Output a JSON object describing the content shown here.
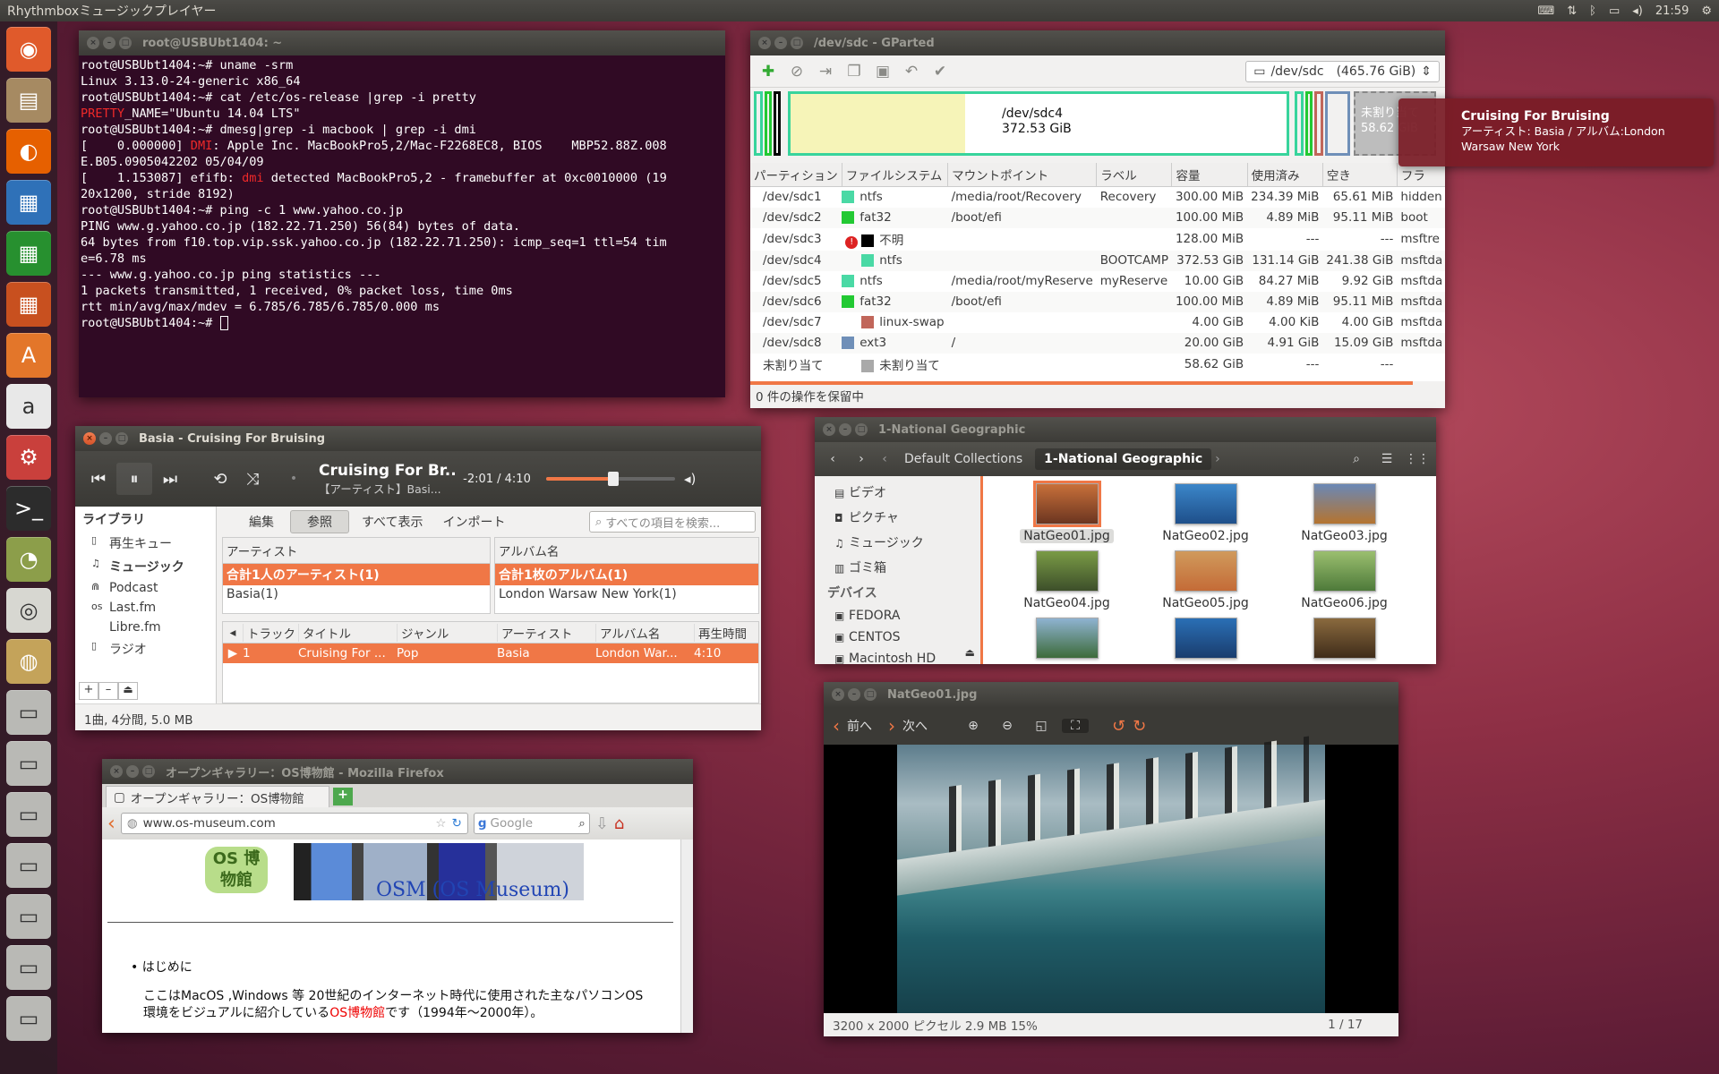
{
  "topbar": {
    "app_title": "Rhythmboxミュージックプレイヤー",
    "clock": "21:59",
    "indicators": [
      "keyboard-icon",
      "network-icon",
      "bluetooth-icon",
      "battery-icon",
      "volume-icon",
      "gear-icon"
    ]
  },
  "launcher": {
    "items": [
      {
        "name": "ubuntu-dash-icon",
        "glyph": "◉",
        "color": "#e05a2b"
      },
      {
        "name": "files-icon",
        "glyph": "▤",
        "color": "#a68a62"
      },
      {
        "name": "firefox-icon",
        "glyph": "◐",
        "color": "#e66000"
      },
      {
        "name": "writer-icon",
        "glyph": "▦",
        "color": "#2f71b8"
      },
      {
        "name": "calc-icon",
        "glyph": "▦",
        "color": "#27902f"
      },
      {
        "name": "impress-icon",
        "glyph": "▦",
        "color": "#c8501f"
      },
      {
        "name": "software-center-icon",
        "glyph": "A",
        "color": "#e3762a"
      },
      {
        "name": "amazon-icon",
        "glyph": "a",
        "color": "#e8e8e8"
      },
      {
        "name": "settings-icon",
        "glyph": "⚙",
        "color": "#c9403c"
      },
      {
        "name": "terminal-icon",
        "glyph": ">_",
        "color": "#2c2c2c"
      },
      {
        "name": "gparted-icon",
        "glyph": "◔",
        "color": "#8c9e4a"
      },
      {
        "name": "rhythmbox-icon",
        "glyph": "◎",
        "color": "#d7d7d1"
      },
      {
        "name": "image-viewer-icon",
        "glyph": "◍",
        "color": "#c4a35a"
      },
      {
        "name": "drive-icon-1",
        "glyph": "▭",
        "color": "#b9b9b5"
      },
      {
        "name": "drive-icon-2",
        "glyph": "▭",
        "color": "#b9b9b5"
      },
      {
        "name": "drive-icon-3",
        "glyph": "▭",
        "color": "#b9b9b5"
      },
      {
        "name": "drive-icon-4",
        "glyph": "▭",
        "color": "#b9b9b5"
      },
      {
        "name": "drive-icon-5",
        "glyph": "▭",
        "color": "#b9b9b5"
      },
      {
        "name": "drive-icon-6",
        "glyph": "▭",
        "color": "#b9b9b5"
      },
      {
        "name": "drive-icon-7",
        "glyph": "▭",
        "color": "#b9b9b5"
      }
    ]
  },
  "terminal": {
    "title": "root@USBUbt1404: ~",
    "lines": [
      [
        {
          "t": "root@USBUbt1404:~# uname -srm"
        }
      ],
      [
        {
          "t": "Linux 3.13.0-24-generic x86_64"
        }
      ],
      [
        {
          "t": "root@USBUbt1404:~# cat /etc/os-release |grep -i pretty"
        }
      ],
      [
        {
          "t": "PRETTY",
          "c": "red"
        },
        {
          "t": "_NAME=\"Ubuntu 14.04 LTS\""
        }
      ],
      [
        {
          "t": "root@USBUbt1404:~# dmesg|grep -i macbook | grep -i dmi"
        }
      ],
      [
        {
          "t": "[    0.000000] "
        },
        {
          "t": "DMI",
          "c": "red"
        },
        {
          "t": ": Apple Inc. MacBookPro5,2/Mac-F2268EC8, BIOS    MBP52.88Z.008"
        }
      ],
      [
        {
          "t": "E.B05.0905042202 05/04/09"
        }
      ],
      [
        {
          "t": "[    1.153087] efifb: "
        },
        {
          "t": "dmi",
          "c": "red"
        },
        {
          "t": " detected MacBookPro5,2 - framebuffer at 0xc0010000 (19"
        }
      ],
      [
        {
          "t": "20x1200, stride 8192)"
        }
      ],
      [
        {
          "t": "root@USBUbt1404:~# ping -c 1 www.yahoo.co.jp"
        }
      ],
      [
        {
          "t": "PING www.g.yahoo.co.jp (182.22.71.250) 56(84) bytes of data."
        }
      ],
      [
        {
          "t": "64 bytes from f10.top.vip.ssk.yahoo.co.jp (182.22.71.250): icmp_seq=1 ttl=54 tim"
        }
      ],
      [
        {
          "t": "e=6.78 ms"
        }
      ],
      [
        {
          "t": ""
        }
      ],
      [
        {
          "t": "--- www.g.yahoo.co.jp ping statistics ---"
        }
      ],
      [
        {
          "t": "1 packets transmitted, 1 received, 0% packet loss, time 0ms"
        }
      ],
      [
        {
          "t": "rtt min/avg/max/mdev = 6.785/6.785/6.785/0.000 ms"
        }
      ],
      [
        {
          "t": "root@USBUbt1404:~# "
        }
      ]
    ]
  },
  "gparted": {
    "title": "/dev/sdc - GParted",
    "device_label": "/dev/sdc",
    "device_size": "(465.76 GiB)",
    "map_main_name": "/dev/sdc4",
    "map_main_size": "372.53 GiB",
    "map_unalloc_name": "未割り当て",
    "map_unalloc_size": "58.62 GiB",
    "map_main_used_fraction": 0.352,
    "columns": [
      "パーティション",
      "ファイルシステム",
      "マウントポイント",
      "ラベル",
      "容量",
      "使用済み",
      "空き",
      "フラ"
    ],
    "rows": [
      {
        "part": "/dev/sdc1",
        "icon": "key",
        "color": "#4ad9a5",
        "fs": "ntfs",
        "mount": "/media/root/Recovery",
        "label": "Recovery",
        "size": "300.00 MiB",
        "used": "234.39 MiB",
        "free": "65.61 MiB",
        "flags": "hidden"
      },
      {
        "part": "/dev/sdc2",
        "icon": "key",
        "color": "#22c933",
        "fs": "fat32",
        "mount": "/boot/efi",
        "label": "",
        "size": "100.00 MiB",
        "used": "4.89 MiB",
        "free": "95.11 MiB",
        "flags": "boot"
      },
      {
        "part": "/dev/sdc3",
        "icon": "warn",
        "color": "#000000",
        "fs": "不明",
        "mount": "",
        "label": "",
        "size": "128.00 MiB",
        "used": "---",
        "free": "---",
        "flags": "msftre"
      },
      {
        "part": "/dev/sdc4",
        "icon": "",
        "color": "#4ad9a5",
        "fs": "ntfs",
        "mount": "",
        "label": "BOOTCAMP",
        "size": "372.53 GiB",
        "used": "131.14 GiB",
        "free": "241.38 GiB",
        "flags": "msftda"
      },
      {
        "part": "/dev/sdc5",
        "icon": "key",
        "color": "#4ad9a5",
        "fs": "ntfs",
        "mount": "/media/root/myReserve",
        "label": "myReserve",
        "size": "10.00 GiB",
        "used": "84.27 MiB",
        "free": "9.92 GiB",
        "flags": "msftda"
      },
      {
        "part": "/dev/sdc6",
        "icon": "key",
        "color": "#22c933",
        "fs": "fat32",
        "mount": "/boot/efi",
        "label": "",
        "size": "100.00 MiB",
        "used": "4.89 MiB",
        "free": "95.11 MiB",
        "flags": "msftda"
      },
      {
        "part": "/dev/sdc7",
        "icon": "",
        "color": "#c1665a",
        "fs": "linux-swap",
        "mount": "",
        "label": "",
        "size": "4.00 GiB",
        "used": "4.00 KiB",
        "free": "4.00 GiB",
        "flags": "msftda"
      },
      {
        "part": "/dev/sdc8",
        "icon": "key",
        "color": "#6f8fb8",
        "fs": "ext3",
        "mount": "/",
        "label": "",
        "size": "20.00 GiB",
        "used": "4.91 GiB",
        "free": "15.09 GiB",
        "flags": "msftda"
      },
      {
        "part": "未割り当て",
        "icon": "",
        "color": "#a9a9a9",
        "fs": "未割り当て",
        "mount": "",
        "label": "",
        "size": "58.62 GiB",
        "used": "---",
        "free": "---",
        "flags": ""
      }
    ],
    "status": "0 件の操作を保留中"
  },
  "notification": {
    "title": "Cruising For Bruising",
    "body": "アーティスト: Basia / アルバム:London Warsaw New York"
  },
  "rhythmbox": {
    "title": "Basia - Cruising For Bruising",
    "now_title": "Cruising For Br...",
    "now_sub": "【アーティスト】Basi...",
    "time": "-2:01 / 4:10",
    "progress": 0.52,
    "library_head": "ライブラリ",
    "library": [
      {
        "name": "play-queue",
        "icon": "▯",
        "label": "再生キュー",
        "bold": false
      },
      {
        "name": "music",
        "icon": "♫",
        "label": "ミュージック",
        "bold": true
      },
      {
        "name": "podcast",
        "icon": "⋒",
        "label": "Podcast",
        "bold": false
      },
      {
        "name": "lastfm",
        "icon": "os",
        "label": "Last.fm",
        "bold": false
      },
      {
        "name": "librefm",
        "icon": "",
        "label": "Libre.fm",
        "bold": false
      },
      {
        "name": "radio",
        "icon": "▯",
        "label": "ラジオ",
        "bold": false
      }
    ],
    "toolbar": {
      "edit": "編集",
      "browse": "参照",
      "show_all": "すべて表示",
      "import": "インポート"
    },
    "search_placeholder": "すべての項目を検索...",
    "artist_head": "アーティスト",
    "artist_all": "合計1人のアーティスト(1)",
    "artist_item": "Basia(1)",
    "album_head": "アルバム名",
    "album_all": "合計1枚のアルバム(1)",
    "album_item": "London Warsaw New York(1)",
    "track_columns": [
      "トラック",
      "タイトル",
      "ジャンル",
      "アーティスト",
      "アルバム名",
      "再生時間"
    ],
    "track": {
      "num": "1",
      "title": "Cruising For ...",
      "genre": "Pop",
      "artist": "Basia",
      "album": "London War...",
      "duration": "4:10"
    },
    "status": "1曲, 4分間, 5.0 MB"
  },
  "files": {
    "title": "1-National Geographic",
    "crumbs": [
      "Default Collections",
      "1-National Geographic"
    ],
    "sidebar": [
      {
        "type": "item",
        "icon": "▤",
        "label": "ビデオ"
      },
      {
        "type": "item",
        "icon": "◘",
        "label": "ピクチャ"
      },
      {
        "type": "item",
        "icon": "♫",
        "label": "ミュージック"
      },
      {
        "type": "item",
        "icon": "▥",
        "label": "ゴミ箱"
      },
      {
        "type": "head",
        "icon": "",
        "label": "デバイス"
      },
      {
        "type": "item",
        "icon": "▣",
        "label": "FEDORA"
      },
      {
        "type": "item",
        "icon": "▣",
        "label": "CENTOS"
      },
      {
        "type": "item",
        "icon": "▣",
        "label": "Macintosh HD"
      }
    ],
    "items": [
      {
        "name": "NatGeo01.jpg",
        "bg": "linear-gradient(#c8703a,#6b3520)",
        "selected": true
      },
      {
        "name": "NatGeo02.jpg",
        "bg": "linear-gradient(#3b86c9,#1e4f8a)"
      },
      {
        "name": "NatGeo03.jpg",
        "bg": "linear-gradient(#6a88b6,#b5742f)"
      },
      {
        "name": "NatGeo04.jpg",
        "bg": "linear-gradient(#7a9b46,#3d4f2a)"
      },
      {
        "name": "NatGeo05.jpg",
        "bg": "linear-gradient(#d09a5c,#c46b37)"
      },
      {
        "name": "NatGeo06.jpg",
        "bg": "linear-gradient(#9bbf6f,#4e7a3a)"
      },
      {
        "name": "",
        "bg": "linear-gradient(#8fb3d1,#3d6b3a)"
      },
      {
        "name": "",
        "bg": "linear-gradient(#2a6fb5,#1a3d6e)"
      },
      {
        "name": "",
        "bg": "linear-gradient(#8a6a3e,#3f2c1a)"
      }
    ]
  },
  "firefox": {
    "title": "オープンギャラリー：OS博物館 - Mozilla Firefox",
    "tab": "オープンギャラリー：OS博物館",
    "url": "www.os-museum.com",
    "search_placeholder": "Google",
    "logo_text": "OS 博物館",
    "logo_title": "OSM (OS Museum)",
    "bullet": "はじめに",
    "para1": "ここはMacOS ,Windows 等 20世紀のインターネット時代に使用された主なパソコンOS",
    "para2a": "環境をビジュアルに紹介している",
    "para2link": "OS博物館",
    "para2b": "です（1994年〜2000年）。"
  },
  "viewer": {
    "title": "NatGeo01.jpg",
    "prev": "前へ",
    "next": "次へ",
    "info": "3200 x 2000 ピクセル  2.9 MB    15%",
    "counter": "1 / 17"
  }
}
